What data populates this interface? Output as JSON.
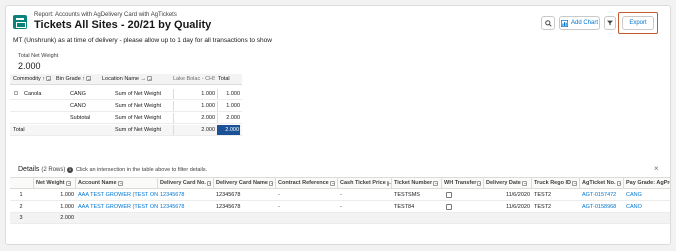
{
  "header": {
    "subtitle": "Report: Accounts with AgDelivery Card with AgTickets",
    "title": "Tickets All Sites - 20/21 by Quality",
    "description": "MT (Unshrunk) as at time of delivery - please allow up to 1 day for all transactions to show",
    "add_chart_label": "Add Chart",
    "export_label": "Export"
  },
  "summary": {
    "label": "Total Net Weight",
    "value": "2.000"
  },
  "matrix": {
    "headers": [
      "Commodity ↑",
      "Bin Grade ↑",
      "Location Name →",
      "Lake Bolac - CHS",
      "Total"
    ],
    "rows": [
      {
        "commodity": "Canola",
        "grade": "CANG",
        "measure": "Sum of Net Weight",
        "v1": "1.000",
        "total": "1.000"
      },
      {
        "commodity": "",
        "grade": "CANO",
        "measure": "Sum of Net Weight",
        "v1": "1.000",
        "total": "1.000"
      },
      {
        "commodity": "",
        "grade": "Subtotal",
        "measure": "Sum of Net Weight",
        "v1": "2.000",
        "total": "2.000"
      },
      {
        "commodity": "Total",
        "grade": "",
        "measure": "Sum of Net Weight",
        "v1": "2.000",
        "total": "2.000"
      }
    ]
  },
  "details": {
    "title": "Details",
    "count": "(2 Rows)",
    "hint": "Click an intersection in the table above to filter details.",
    "close": "×",
    "columns": [
      "Net Weight",
      "Account Name",
      "Delivery Card No.",
      "Delivery Card Name",
      "Contract Reference",
      "Cash Ticket Price",
      "Ticket Number",
      "WH Transfer",
      "Delivery Date",
      "Truck Rego ID",
      "AgTicket No.",
      "Pay Grade: AgPro"
    ],
    "rows": [
      {
        "idx": "1",
        "net": "1.000",
        "account": "AAA TEST GROWER (TEST ONLY)",
        "card_no": "12345678",
        "card_name": "12345678",
        "contract": "-",
        "cash": "-",
        "ticket": "TESTSMS",
        "date": "11/6/2020",
        "truck": "TEST2",
        "agticket": "AGT-0157472",
        "grade": "CANG"
      },
      {
        "idx": "2",
        "net": "1.000",
        "account": "AAA TEST GROWER (TEST ONLY)",
        "card_no": "12345678",
        "card_name": "12345678",
        "contract": "-",
        "cash": "-",
        "ticket": "TEST84",
        "date": "11/6/2020",
        "truck": "TEST2",
        "agticket": "AGT-0158968",
        "grade": "CANO"
      }
    ],
    "total": {
      "idx": "3",
      "net": "2.000"
    }
  }
}
